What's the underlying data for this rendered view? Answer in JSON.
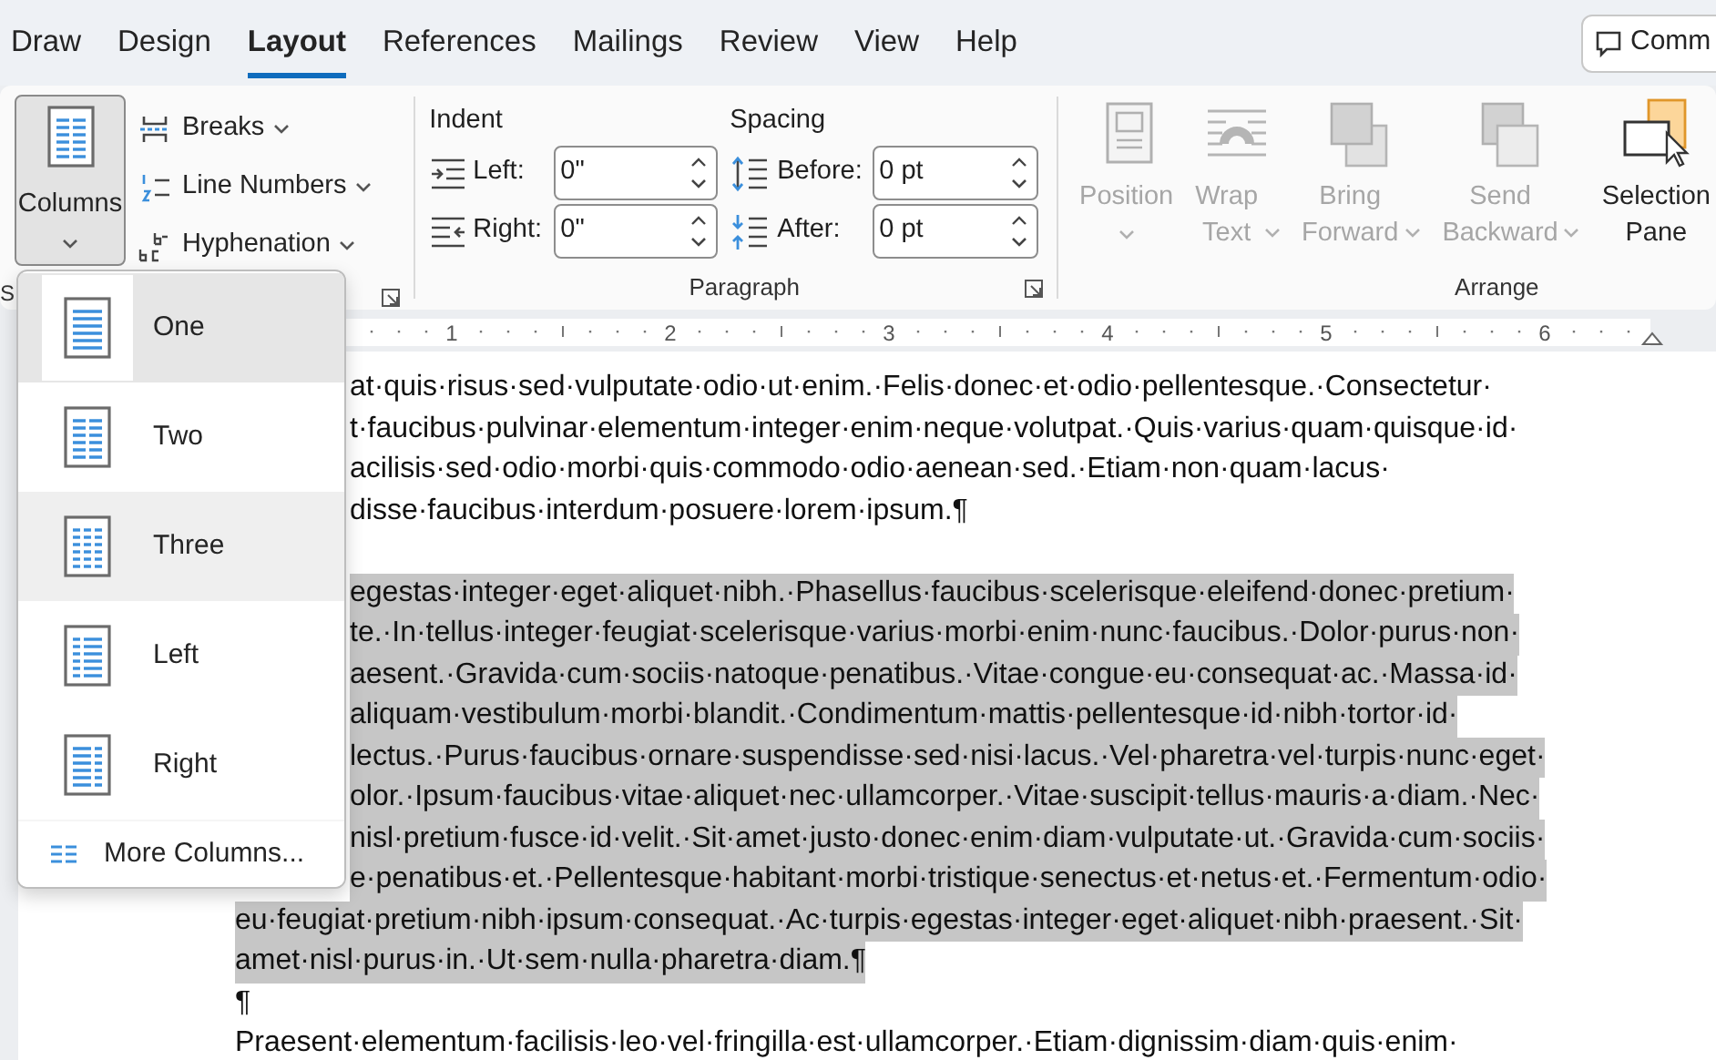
{
  "tabs": [
    {
      "label": "Draw",
      "selected": false
    },
    {
      "label": "Design",
      "selected": false
    },
    {
      "label": "Layout",
      "selected": true
    },
    {
      "label": "References",
      "selected": false
    },
    {
      "label": "Mailings",
      "selected": false
    },
    {
      "label": "Review",
      "selected": false
    },
    {
      "label": "View",
      "selected": false
    },
    {
      "label": "Help",
      "selected": false
    }
  ],
  "comments_button": {
    "label": "Comm"
  },
  "ribbon": {
    "page_setup": {
      "columns": {
        "label": "Columns",
        "pressed": true
      },
      "items": [
        {
          "label": "Breaks",
          "kind": "breaks"
        },
        {
          "label": "Line Numbers",
          "kind": "numbers"
        },
        {
          "label": "Hyphenation",
          "kind": "hyphenation"
        }
      ],
      "group_label": "S"
    },
    "paragraph": {
      "indent_label": "Indent",
      "spacing_label": "Spacing",
      "indent": [
        {
          "label": "Left:",
          "value": "0\"",
          "kind": "left"
        },
        {
          "label": "Right:",
          "value": "0\"",
          "kind": "right"
        }
      ],
      "spacing": [
        {
          "label": "Before:",
          "value": "0 pt",
          "kind": "before"
        },
        {
          "label": "After:",
          "value": "0 pt",
          "kind": "after"
        }
      ],
      "group_label": "Paragraph"
    },
    "arrange": {
      "items": [
        {
          "label": "Position",
          "kind": "position",
          "disabled": true,
          "has_menu": true
        },
        {
          "label": "Wrap Text",
          "kind": "wrap",
          "disabled": true,
          "has_menu": true
        },
        {
          "label": "Bring Forward",
          "kind": "forward",
          "disabled": true,
          "has_menu": true
        },
        {
          "label": "Send Backward",
          "kind": "backward",
          "disabled": true,
          "has_menu": true
        },
        {
          "label": "Selection Pane",
          "kind": "selection",
          "disabled": false,
          "has_menu": false
        }
      ],
      "group_label": "Arrange"
    }
  },
  "ruler": {
    "labels": [
      "1",
      "2",
      "3",
      "4",
      "5",
      "6"
    ]
  },
  "document": {
    "paragraphs": [
      {
        "selected": false,
        "lines": [
          {
            "text": "at·quis·risus·sed·vulputate·odio·ut·enim.·Felis·donec·et·odio·pellentesque.·Consectetur·",
            "clipped": true
          },
          {
            "text": "t·faucibus·pulvinar·elementum·integer·enim·neque·volutpat.·Quis·varius·quam·quisque·id·",
            "clipped": true
          },
          {
            "text": "acilisis·sed·odio·morbi·quis·commodo·odio·aenean·sed.·Etiam·non·quam·lacus·",
            "clipped": true
          },
          {
            "text": "disse·faucibus·interdum·posuere·lorem·ipsum.¶",
            "clipped": true
          }
        ]
      },
      {
        "selected": true,
        "lines": [
          {
            "text": "egestas·integer·eget·aliquet·nibh.·Phasellus·faucibus·scelerisque·eleifend·donec·pretium·",
            "clipped": true
          },
          {
            "text": "te.·In·tellus·integer·feugiat·scelerisque·varius·morbi·enim·nunc·faucibus.·Dolor·purus·non·",
            "clipped": true
          },
          {
            "text": "aesent.·Gravida·cum·sociis·natoque·penatibus.·Vitae·congue·eu·consequat·ac.·Massa·id·",
            "clipped": true
          },
          {
            "text": "aliquam·vestibulum·morbi·blandit.·Condimentum·mattis·pellentesque·id·nibh·tortor·id·",
            "clipped": true
          },
          {
            "text": "lectus.·Purus·faucibus·ornare·suspendisse·sed·nisi·lacus.·Vel·pharetra·vel·turpis·nunc·eget·",
            "clipped": true
          },
          {
            "text": "olor.·Ipsum·faucibus·vitae·aliquet·nec·ullamcorper.·Vitae·suscipit·tellus·mauris·a·diam.·Nec·",
            "clipped": true
          },
          {
            "text": "nisl·pretium·fusce·id·velit.·Sit·amet·justo·donec·enim·diam·vulputate·ut.·Gravida·cum·sociis·",
            "clipped": true
          },
          {
            "text": "e·penatibus·et.·Pellentesque·habitant·morbi·tristique·senectus·et·netus·et.·Fermentum·odio·",
            "clipped": true
          },
          {
            "text": "eu·feugiat·pretium·nibh·ipsum·consequat.·Ac·turpis·egestas·integer·eget·aliquet·nibh·praesent.·Sit·"
          },
          {
            "text": "amet·nisl·purus·in.·Ut·sem·nulla·pharetra·diam.¶"
          }
        ]
      },
      {
        "selected": false,
        "lines": [
          {
            "text": "¶"
          }
        ]
      },
      {
        "selected": false,
        "lines": [
          {
            "text": "Praesent·elementum·facilisis·leo·vel·fringilla·est·ullamcorper.·Etiam·dignissim·diam·quis·enim·"
          }
        ]
      }
    ]
  },
  "columns_menu": {
    "items": [
      {
        "label": "One",
        "kind": "one",
        "selected": true,
        "hovered": false
      },
      {
        "label": "Two",
        "kind": "two",
        "selected": false,
        "hovered": false
      },
      {
        "label": "Three",
        "kind": "three",
        "selected": false,
        "hovered": true
      },
      {
        "label": "Left",
        "kind": "left",
        "selected": false,
        "hovered": false
      },
      {
        "label": "Right",
        "kind": "right",
        "selected": false,
        "hovered": false
      }
    ],
    "more": {
      "label": "More Columns..."
    }
  }
}
